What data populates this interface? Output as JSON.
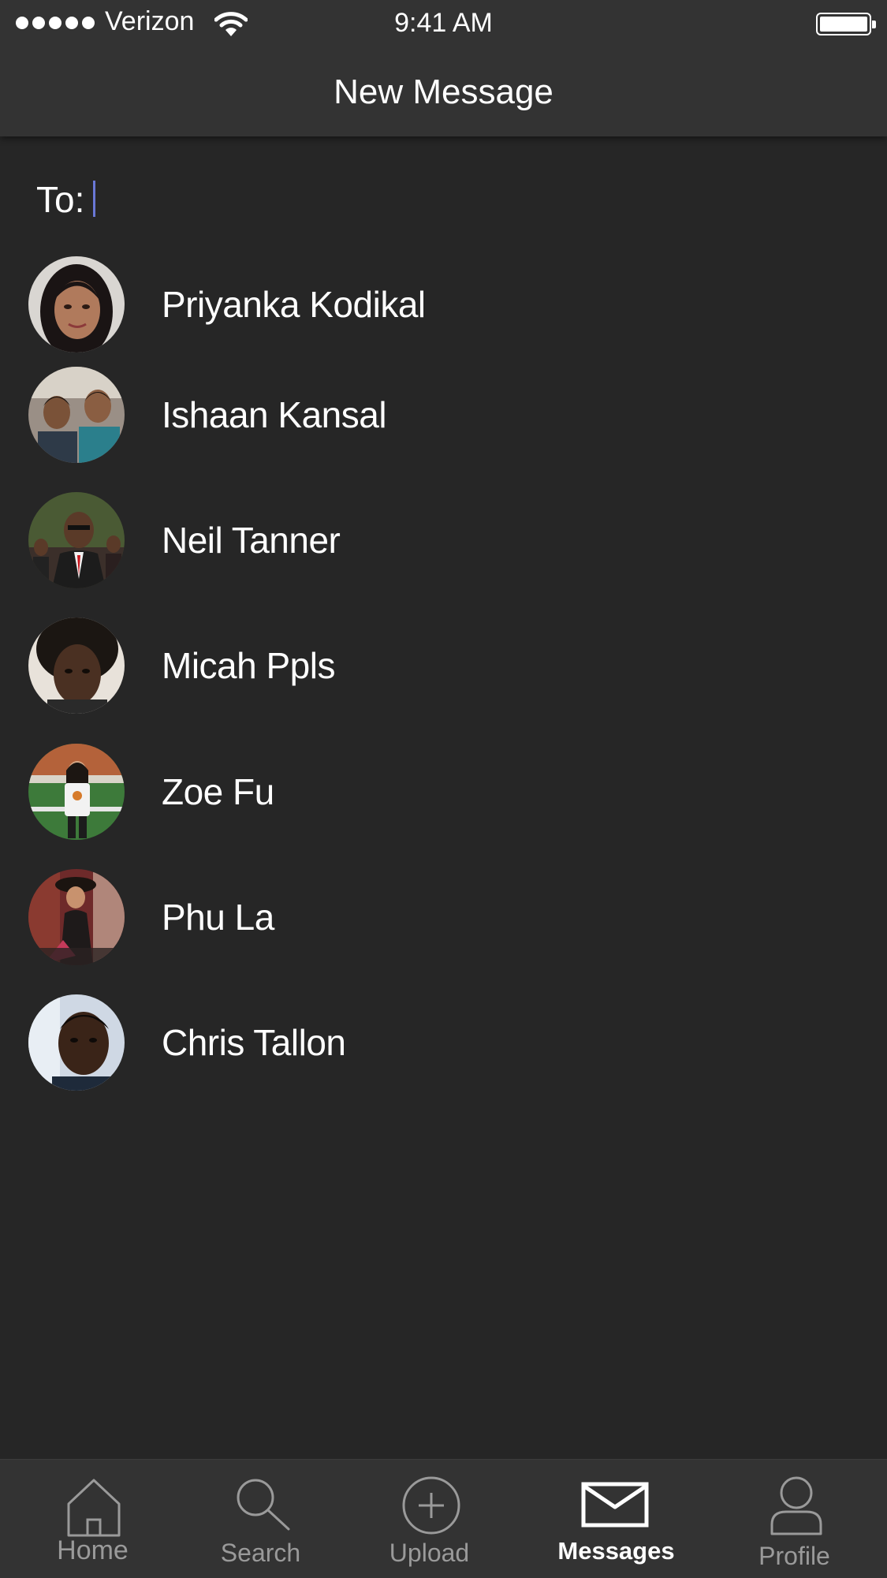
{
  "status_bar": {
    "carrier": "Verizon",
    "time": "9:41 AM",
    "signal_bars": 5
  },
  "nav": {
    "title": "New Message"
  },
  "compose": {
    "to_label": "To:",
    "to_value": "",
    "to_placeholder": ""
  },
  "contacts": [
    {
      "name": "Priyanka Kodikal"
    },
    {
      "name": "Ishaan Kansal"
    },
    {
      "name": "Neil Tanner"
    },
    {
      "name": "Micah Ppls"
    },
    {
      "name": "Zoe Fu"
    },
    {
      "name": "Phu La"
    },
    {
      "name": "Chris Tallon"
    }
  ],
  "tab_bar": {
    "active": "Messages",
    "tabs": [
      {
        "label": "Home",
        "icon": "home-icon"
      },
      {
        "label": "Search",
        "icon": "search-icon"
      },
      {
        "label": "Upload",
        "icon": "upload-icon"
      },
      {
        "label": "Messages",
        "icon": "envelope-icon"
      },
      {
        "label": "Profile",
        "icon": "person-icon"
      }
    ]
  },
  "colors": {
    "background": "#262626",
    "header": "#333333",
    "tab_bar": "#333333",
    "cursor_accent": "#6a78d6",
    "inactive_tab": "#9a9a9a",
    "text": "#ffffff"
  }
}
